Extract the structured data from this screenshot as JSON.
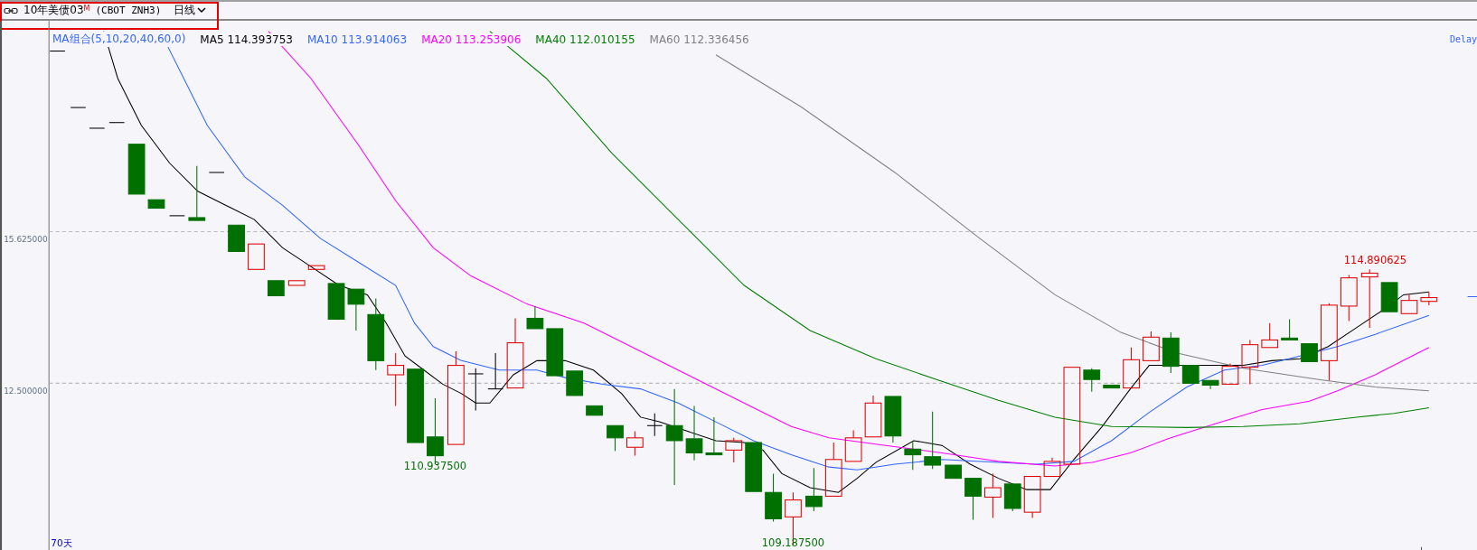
{
  "header": {
    "title": "10年美债03",
    "flag": "M",
    "code": "(CBOT ZNH3)",
    "period": "日线",
    "highlighted": true
  },
  "legend": {
    "label": "MA组合(5,10,20,40,60,0)",
    "status": "Delay",
    "items": [
      {
        "name": "MA5",
        "value": "114.393753",
        "color": "#000000"
      },
      {
        "name": "MA10",
        "value": "113.914063",
        "color": "#3366ff"
      },
      {
        "name": "MA20",
        "value": "113.253906",
        "color": "#ff00ff"
      },
      {
        "name": "MA40",
        "value": "112.010155",
        "color": "#008000"
      },
      {
        "name": "MA60",
        "value": "112.336456",
        "color": "#808080"
      }
    ]
  },
  "axis": {
    "labels": [
      "15.625000",
      "12.500000"
    ],
    "span": "70天"
  },
  "annotations": [
    {
      "text": "114.890625",
      "kind": "high"
    },
    {
      "text": "110.937500",
      "kind": "low"
    },
    {
      "text": "109.187500",
      "kind": "low"
    }
  ]
}
